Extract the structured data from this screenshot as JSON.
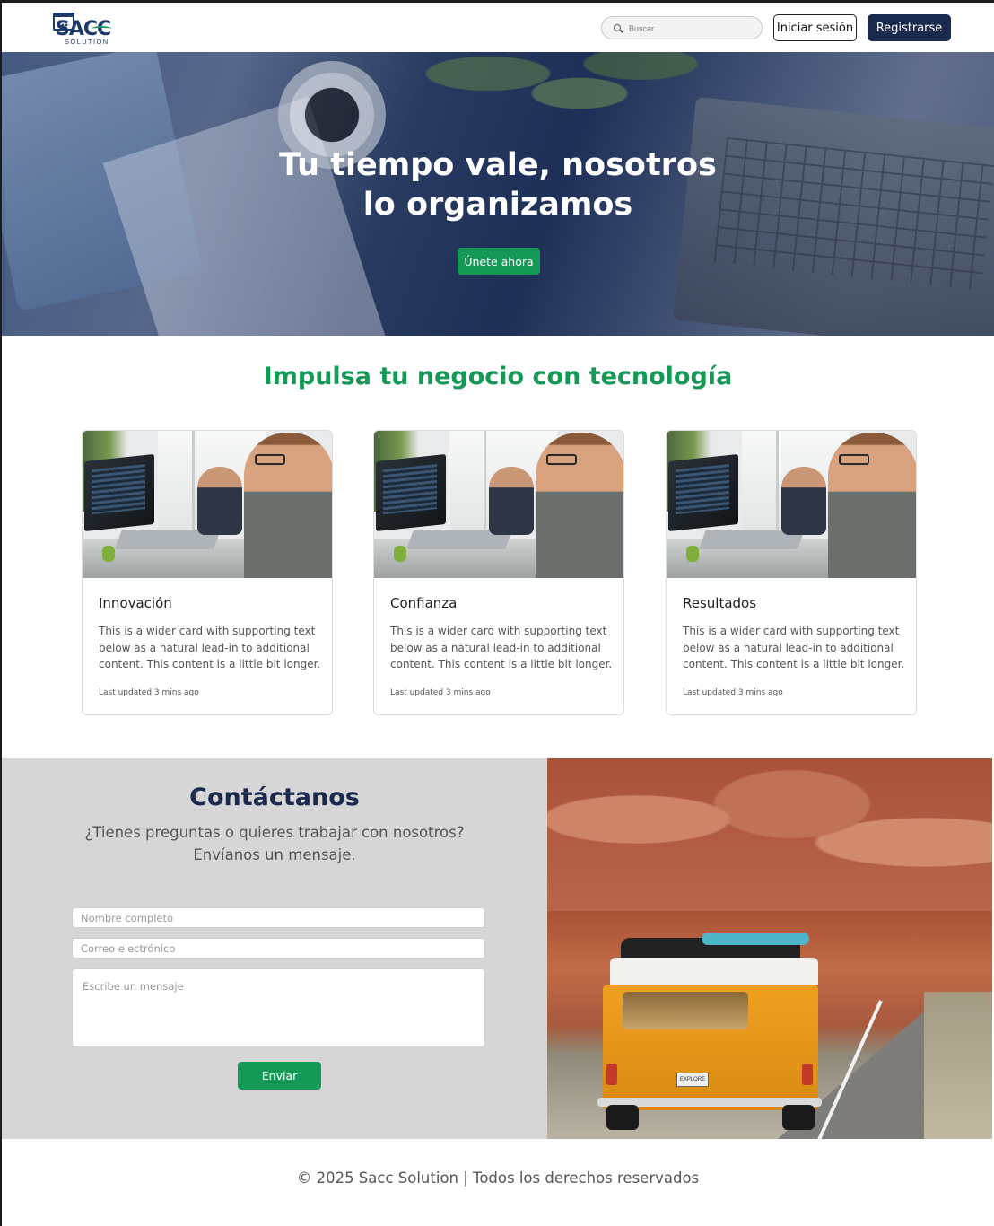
{
  "header": {
    "logo_text": "SACC",
    "logo_subtext": "SOLUTION",
    "search_placeholder": "Buscar",
    "login_label": "Iniciar sesión",
    "register_label": "Registrarse"
  },
  "hero": {
    "title_line1": "Tu tiempo vale, nosotros",
    "title_line2": "lo organizamos",
    "cta_label": "Únete ahora"
  },
  "features": {
    "title": "Impulsa tu negocio con tecnología",
    "cards": [
      {
        "title": "Innovación",
        "text": "This is a wider card with supporting text below as a natural lead-in to additional content. This content is a little bit longer.",
        "footer": "Last updated 3 mins ago"
      },
      {
        "title": "Confianza",
        "text": "This is a wider card with supporting text below as a natural lead-in to additional content. This content is a little bit longer.",
        "footer": "Last updated 3 mins ago"
      },
      {
        "title": "Resultados",
        "text": "This is a wider card with supporting text below as a natural lead-in to additional content. This content is a little bit longer.",
        "footer": "Last updated 3 mins ago"
      }
    ]
  },
  "contact": {
    "title": "Contáctanos",
    "subtitle": "¿Tienes preguntas o quieres trabajar con nosotros? Envíanos un mensaje.",
    "name_placeholder": "Nombre completo",
    "email_placeholder": "Correo electrónico",
    "message_placeholder": "Escribe un mensaje",
    "send_label": "Enviar",
    "plate_text": "EXPLORE"
  },
  "footer": {
    "text": "© 2025 Sacc Solution | Todos los derechos reservados"
  },
  "colors": {
    "primary_navy": "#1a2a4e",
    "accent_green": "#149a56",
    "contact_bg": "#d6d6d6"
  }
}
